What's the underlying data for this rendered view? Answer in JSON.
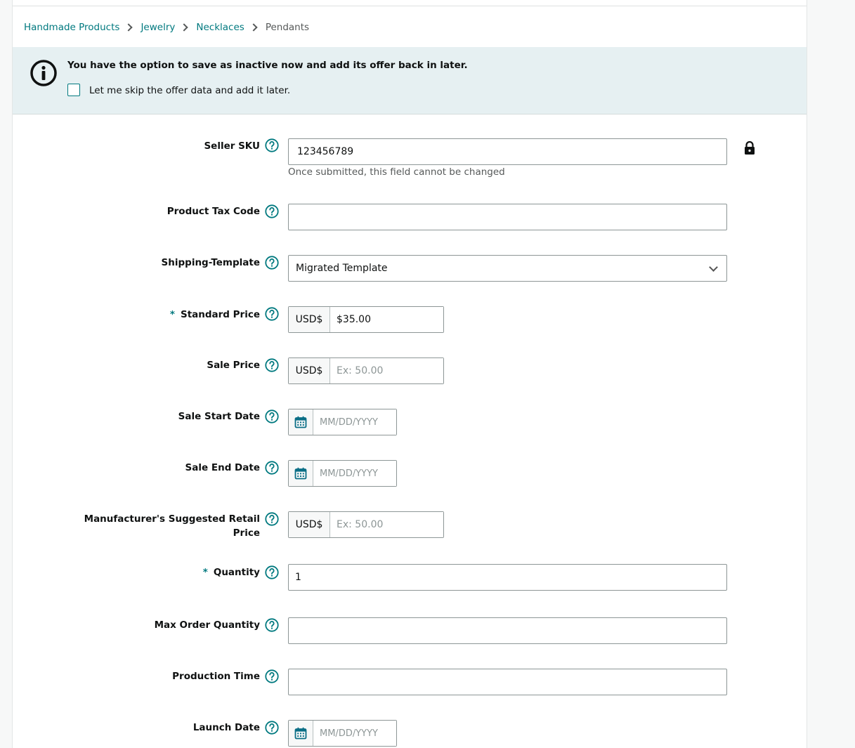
{
  "breadcrumb": {
    "items": [
      "Handmade Products",
      "Jewelry",
      "Necklaces"
    ],
    "current": "Pendants"
  },
  "banner": {
    "title": "You have the option to save as inactive now and add its offer back in later.",
    "checkbox_label": "Let me skip the offer data and add it later.",
    "checkbox_checked": false
  },
  "form": {
    "seller_sku": {
      "label": "Seller SKU",
      "value": "123456789",
      "hint": "Once submitted, this field cannot be changed"
    },
    "product_tax_code": {
      "label": "Product Tax Code",
      "value": ""
    },
    "shipping_template": {
      "label": "Shipping-Template",
      "selected": "Migrated Template"
    },
    "standard_price": {
      "label": "Standard Price",
      "required_mark": "*",
      "currency": "USD$",
      "value": "$35.00"
    },
    "sale_price": {
      "label": "Sale Price",
      "currency": "USD$",
      "placeholder": "Ex: 50.00"
    },
    "sale_start_date": {
      "label": "Sale Start Date",
      "placeholder": "MM/DD/YYYY"
    },
    "sale_end_date": {
      "label": "Sale End Date",
      "placeholder": "MM/DD/YYYY"
    },
    "msrp": {
      "label_line1": "Manufacturer's Suggested Retail",
      "label_line2": "Price",
      "currency": "USD$",
      "placeholder": "Ex: 50.00"
    },
    "quantity": {
      "label": "Quantity",
      "required_mark": "*",
      "value": "1"
    },
    "max_order_quantity": {
      "label": "Max Order Quantity",
      "value": ""
    },
    "production_time": {
      "label": "Production Time",
      "value": ""
    },
    "launch_date": {
      "label": "Launch Date",
      "placeholder": "MM/DD/YYYY"
    }
  },
  "icons": {
    "info": "info-circle-icon",
    "help": "question-circle-icon",
    "lock": "lock-icon",
    "calendar": "calendar-icon",
    "dropdown": "chevron-down-icon"
  },
  "colors": {
    "accent": "#00797f",
    "banner_bg": "#e6f0f2",
    "border": "#8d9696"
  }
}
